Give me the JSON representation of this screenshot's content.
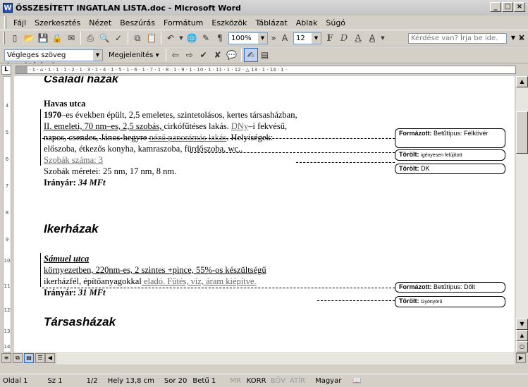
{
  "window": {
    "title": "ÖSSZESÍTETT INGATLAN LISTA.doc - Microsoft Word",
    "buttons": [
      "_",
      "□",
      "×"
    ]
  },
  "menubar": {
    "items": [
      "Fájl",
      "Szerkesztés",
      "Nézet",
      "Beszúrás",
      "Formátum",
      "Eszközök",
      "Táblázat",
      "Ablak",
      "Súgó"
    ],
    "ask_placeholder": "Kérdése van? Írja be ide.",
    "doc_close": "×"
  },
  "standard_toolbar": {
    "zoom": "100%",
    "font_size": "12",
    "format_letters": [
      "F",
      "D",
      "A"
    ]
  },
  "review_toolbar": {
    "view_mode": "Végleges szöveg korrektúrával",
    "show_label": "Megjelenítés"
  },
  "ruler": {
    "corner": "L",
    "ticks": "· 1 · ⌂ · 1 · 1 · 1 · 2 · 1 · 3 · 1 · 4 · 1 · 5 · 1 · 6 · 1 · 7 · 1 · 8 · 1 · 9 · 1 · 10 · 1 · 11 · 1 · 12 · △ 13 · 1 · 14 · 1 ·",
    "vertical_numbers": [
      "4",
      "5",
      "6",
      "7",
      "8",
      "9",
      "10",
      "11",
      "12",
      "13",
      "14"
    ]
  },
  "document": {
    "section1_heading": "Családi házak",
    "street1": "Havas utca",
    "p1_year": "1970",
    "p1_l1": "–es években épült, 2,5 emeletes, szintetolásos, kertes társasházban,",
    "p1_l2a": "II. emeleti, 70 nm–es, 2,5 szobás, ",
    "p1_l2b": "cirkófűtéses lakás. ",
    "p1_l2c": "DNy",
    "p1_l2d": "–i fekvésű,",
    "p1_l3a": "napos, csendes, János-hegyre ",
    "p1_l3b": "néző panorámás lakás",
    "p1_l3c": ". Helyiségek:",
    "p1_l4": "előszoba, étkezős konyha, kamraszoba, fürdőszoba, wc,.",
    "rooms_count": "Szobák száma: 3",
    "rooms_sizes": "Szobák méretei: 25 nm, 17 nm, 8 nm.",
    "price1_label": "Irányár: ",
    "price1_value": "34 MFt",
    "section2_heading": "Ikerházak",
    "street2": "Sámuel utca",
    "p2_l1": "környezetben, 220nm-es, 2 szintes +pince, 55%-os készültségű",
    "p2_l2a": "ikerházfél, építőanyagokkal",
    "p2_l2b": " eladó. Fűtés, víz, áram kiépítve.",
    "price2_label": "Irányár: ",
    "price2_value": "31 MFt",
    "section3_heading": "Társasházak"
  },
  "balloons": [
    {
      "kind": "Formázott:",
      "text": "Betűtípus: Félkövér"
    },
    {
      "kind": "Törölt:",
      "text": "igényesen felújított"
    },
    {
      "kind": "Törölt:",
      "text": "DK"
    },
    {
      "kind": "Formázott:",
      "text": "Betűtípus: Dőlt"
    },
    {
      "kind": "Törölt:",
      "text": "Gyönyörű"
    }
  ],
  "statusbar": {
    "page": "Oldal 1",
    "section": "Sz 1",
    "pages": "1/2",
    "position": "Hely 13,8 cm",
    "line": "Sor 20",
    "column": "Betű 1",
    "mr": "MR",
    "korr": "KORR",
    "bov": "BŐV",
    "atir": "ÁTÍR",
    "language": "Magyar"
  }
}
